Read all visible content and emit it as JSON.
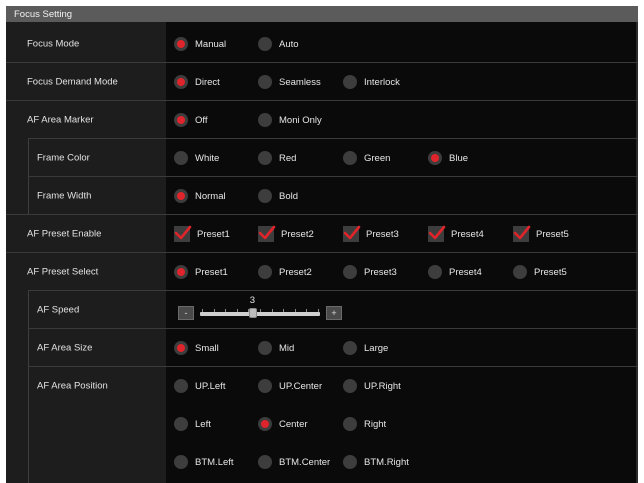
{
  "section": {
    "title": "Focus Setting"
  },
  "rows": {
    "focus_mode": {
      "label": "Focus Mode",
      "options": [
        "Manual",
        "Auto"
      ],
      "selected": "Manual"
    },
    "focus_demand_mode": {
      "label": "Focus Demand Mode",
      "options": [
        "Direct",
        "Seamless",
        "Interlock"
      ],
      "selected": "Direct"
    },
    "af_area_marker": {
      "label": "AF Area Marker",
      "options": [
        "Off",
        "Moni Only"
      ],
      "selected": "Off"
    },
    "frame_color": {
      "label": "Frame Color",
      "options": [
        "White",
        "Red",
        "Green",
        "Blue"
      ],
      "selected": "Blue"
    },
    "frame_width": {
      "label": "Frame Width",
      "options": [
        "Normal",
        "Bold"
      ],
      "selected": "Normal"
    },
    "af_preset_enable": {
      "label": "AF Preset Enable",
      "options": [
        "Preset1",
        "Preset2",
        "Preset3",
        "Preset4",
        "Preset5"
      ],
      "checked": [
        true,
        true,
        true,
        true,
        true
      ]
    },
    "af_preset_select": {
      "label": "AF Preset Select",
      "options": [
        "Preset1",
        "Preset2",
        "Preset3",
        "Preset4",
        "Preset5"
      ],
      "selected": "Preset1"
    },
    "af_speed": {
      "label": "AF Speed",
      "value": "3",
      "decrement_label": "-",
      "increment_label": "+",
      "level_fraction": 0.3
    },
    "af_area_size": {
      "label": "AF Area Size",
      "options": [
        "Small",
        "Mid",
        "Large"
      ],
      "selected": "Small"
    },
    "af_area_position": {
      "label": "AF Area Position",
      "options": [
        [
          "UP.Left",
          "UP.Center",
          "UP.Right"
        ],
        [
          "Left",
          "Center",
          "Right"
        ],
        [
          "BTM.Left",
          "BTM.Center",
          "BTM.Right"
        ]
      ],
      "selected": "Center"
    }
  },
  "colors": {
    "accent": "#e0242b",
    "panel_bg": "#0a0a0a",
    "label_bg": "#1d1d1d",
    "header_bg": "#5b5b5b",
    "control_bg": "#3d3d3d"
  }
}
